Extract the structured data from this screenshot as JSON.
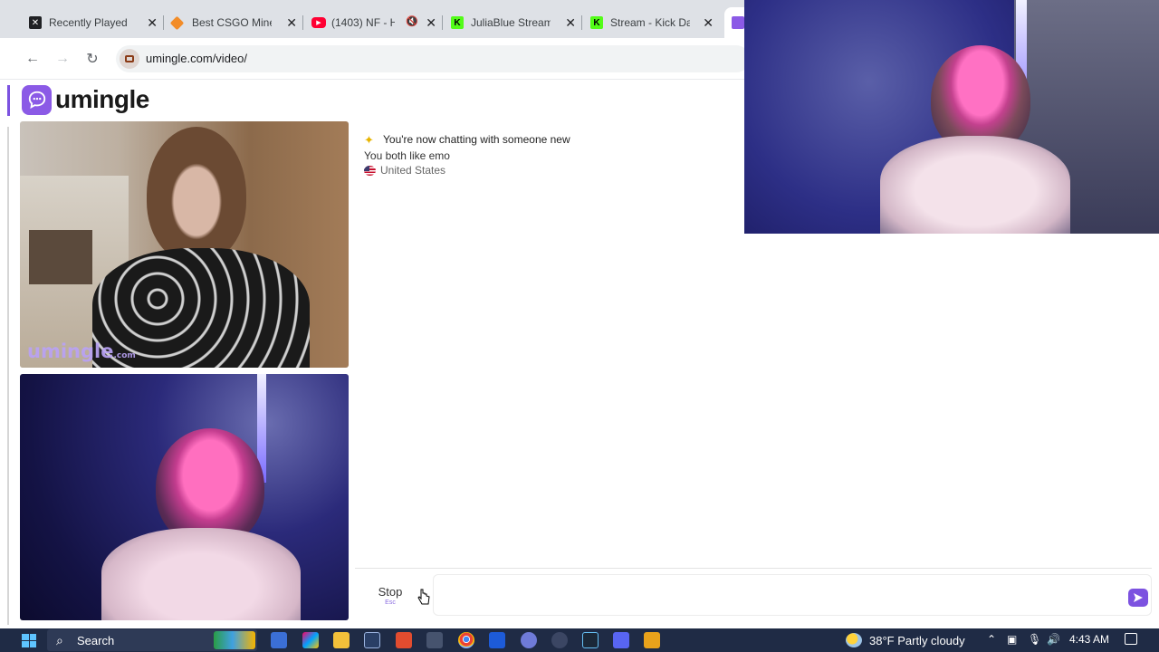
{
  "browser": {
    "tabs": [
      {
        "title": "Recently Played –",
        "favicon": "x-logo-icon",
        "color": "#202124"
      },
      {
        "title": "Best CSGO Mines",
        "favicon": "orange-diamond-icon",
        "color": "#f28c28"
      },
      {
        "title": "(1403) NF - H",
        "favicon": "youtube-icon",
        "color": "#ff0033",
        "muted": true
      },
      {
        "title": "JuliaBlue Stream",
        "favicon": "kick-icon",
        "color": "#53fc18"
      },
      {
        "title": "Stream - Kick Das",
        "favicon": "kick-icon",
        "color": "#53fc18"
      }
    ],
    "url": "umingle.com/video/"
  },
  "page": {
    "logo_text": "umingle",
    "watermark": "umingle",
    "watermark_suffix": ".com",
    "chat": {
      "line1": "You're now chatting with someone new",
      "line2": "You both like emo",
      "line3": "United States"
    },
    "stop_label": "Stop",
    "stop_hint": "Esc",
    "accent_color": "#7c52e0"
  },
  "taskbar": {
    "search_label": "Search",
    "weather": "38°F  Partly cloudy",
    "time": "4:43 AM"
  }
}
